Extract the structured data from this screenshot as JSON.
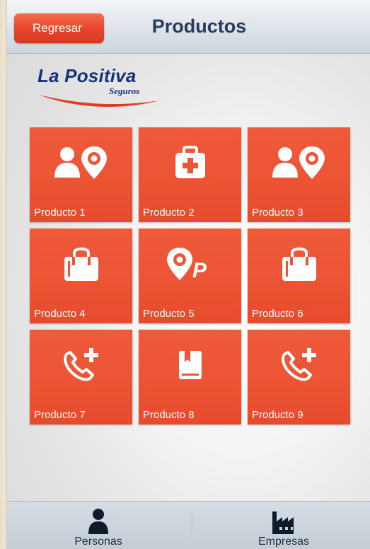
{
  "header": {
    "back_label": "Regresar",
    "title": "Productos"
  },
  "brand": {
    "name": "La Positiva",
    "sub": "Seguros"
  },
  "products": [
    {
      "label": "Producto 1",
      "icon": "person-location-icon"
    },
    {
      "label": "Producto 2",
      "icon": "first-aid-kit-icon"
    },
    {
      "label": "Producto 3",
      "icon": "person-location-icon"
    },
    {
      "label": "Producto 4",
      "icon": "shopping-bag-icon"
    },
    {
      "label": "Producto 5",
      "icon": "parking-location-icon"
    },
    {
      "label": "Producto 6",
      "icon": "shopping-bag-icon"
    },
    {
      "label": "Producto 7",
      "icon": "phone-add-icon"
    },
    {
      "label": "Producto 8",
      "icon": "book-icon"
    },
    {
      "label": "Producto 9",
      "icon": "phone-add-icon"
    }
  ],
  "tabs": [
    {
      "label": "Personas",
      "icon": "person-icon"
    },
    {
      "label": "Empresas",
      "icon": "factory-icon"
    }
  ],
  "colors": {
    "accent": "#e8502f",
    "title": "#2a3a5a",
    "brand": "#16327a"
  }
}
